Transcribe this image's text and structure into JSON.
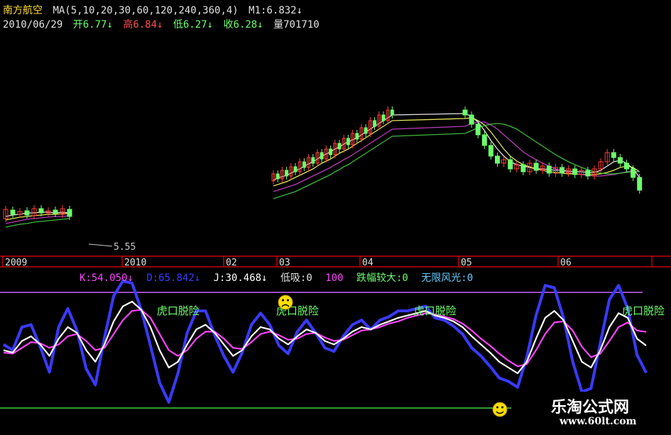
{
  "header": {
    "stock_name": "南方航空",
    "ma_params": "MA(5,10,20,30,60,120,240,360,4)",
    "m1": "M1:6.832",
    "m1_arrow": "↓",
    "date": "2010/06/29",
    "open": "开6.77",
    "open_arrow": "↓",
    "high": "高6.84",
    "high_arrow": "↓",
    "low": "低6.27",
    "low_arrow": "↓",
    "close": "收6.28",
    "close_arrow": "↓",
    "volume": "量701710"
  },
  "indicator_header": {
    "k": "K:54.050",
    "k_arrow": "↓",
    "d": "D:65.842",
    "d_arrow": "↓",
    "j": "J:30.468",
    "j_arrow": "↓",
    "dixi": "低吸:0",
    "hundred": "100",
    "diefu": "跌幅较大:0",
    "wuxian": "无限风光:0"
  },
  "colors": {
    "background": "#000000",
    "up_candle": "#ff3c3c",
    "down_candle": "#6cff6c",
    "k_line": "#ffffff",
    "d_line": "#ff44ff",
    "j_line": "#3a3aff",
    "signal_text": "#6cff6c",
    "axis": "#c80000",
    "level_high": "#cc66ff",
    "level_low": "#44cc44"
  },
  "chart_data": [
    {
      "type": "candlestick",
      "x_tick_labels": [
        "2009",
        "2010",
        "02",
        "03",
        "04",
        "05",
        "06"
      ],
      "price_label": "5.55",
      "candles_open_close": [
        [
          5.52,
          5.65
        ],
        [
          5.64,
          5.58
        ],
        [
          5.58,
          5.62
        ],
        [
          5.63,
          5.57
        ],
        [
          5.56,
          5.66
        ],
        [
          5.66,
          5.6
        ],
        [
          5.6,
          5.63
        ],
        [
          5.64,
          5.59
        ],
        [
          5.58,
          5.66
        ],
        [
          5.65,
          5.55
        ],
        [
          6.05,
          6.15
        ],
        [
          6.15,
          6.08
        ],
        [
          6.08,
          6.2
        ],
        [
          6.2,
          6.12
        ],
        [
          6.12,
          6.25
        ],
        [
          6.25,
          6.18
        ],
        [
          6.18,
          6.32
        ],
        [
          6.32,
          6.24
        ],
        [
          6.24,
          6.38
        ],
        [
          6.38,
          6.3
        ],
        [
          6.3,
          6.45
        ],
        [
          6.45,
          6.36
        ],
        [
          6.36,
          6.5
        ],
        [
          6.5,
          6.42
        ],
        [
          6.42,
          6.58
        ],
        [
          6.58,
          6.5
        ],
        [
          6.5,
          6.65
        ],
        [
          6.65,
          6.56
        ],
        [
          6.56,
          6.72
        ],
        [
          6.72,
          6.64
        ],
        [
          6.64,
          6.8
        ],
        [
          6.8,
          6.72
        ],
        [
          6.72,
          6.9
        ],
        [
          6.9,
          6.82
        ],
        [
          6.82,
          6.98
        ],
        [
          6.98,
          6.9
        ],
        [
          6.9,
          7.05
        ],
        [
          7.05,
          6.98
        ],
        [
          7.05,
          6.98
        ],
        [
          6.98,
          6.85
        ],
        [
          6.85,
          6.7
        ],
        [
          6.7,
          6.55
        ],
        [
          6.55,
          6.4
        ],
        [
          6.4,
          6.3
        ],
        [
          6.3,
          6.35
        ],
        [
          6.35,
          6.22
        ],
        [
          6.22,
          6.28
        ],
        [
          6.28,
          6.18
        ],
        [
          6.18,
          6.3
        ],
        [
          6.3,
          6.2
        ],
        [
          6.2,
          6.26
        ],
        [
          6.26,
          6.16
        ],
        [
          6.16,
          6.24
        ],
        [
          6.24,
          6.16
        ],
        [
          6.16,
          6.22
        ],
        [
          6.22,
          6.14
        ],
        [
          6.14,
          6.2
        ],
        [
          6.2,
          6.12
        ],
        [
          6.12,
          6.22
        ],
        [
          6.22,
          6.32
        ],
        [
          6.32,
          6.45
        ],
        [
          6.45,
          6.38
        ],
        [
          6.38,
          6.3
        ],
        [
          6.3,
          6.22
        ],
        [
          6.22,
          6.1
        ],
        [
          6.1,
          5.92
        ]
      ],
      "ma_series": [
        {
          "values": [
            5.55,
            5.57,
            5.58,
            5.6,
            5.6,
            5.61,
            5.61,
            5.6,
            5.61,
            5.6,
            6.06,
            6.09,
            6.11,
            6.13,
            6.16,
            6.19,
            6.22,
            6.26,
            6.29,
            6.32,
            6.36,
            6.4,
            6.43,
            6.46,
            6.5,
            6.53,
            6.57,
            6.6,
            6.63,
            6.66,
            6.7,
            6.74,
            6.78,
            6.82,
            6.86,
            6.9,
            6.94,
            6.98,
            7.0,
            6.96,
            6.88,
            6.76,
            6.62,
            6.5,
            6.4,
            6.32,
            6.28,
            6.26,
            6.24,
            6.22,
            6.22,
            6.21,
            6.2,
            6.2,
            6.19,
            6.18,
            6.18,
            6.17,
            6.17,
            6.2,
            6.26,
            6.32,
            6.34,
            6.3,
            6.22,
            6.1
          ]
        },
        {
          "values": [
            5.5,
            5.52,
            5.54,
            5.55,
            5.56,
            5.57,
            5.58,
            5.58,
            5.59,
            5.59,
            5.98,
            6.0,
            6.02,
            6.04,
            6.07,
            6.1,
            6.13,
            6.16,
            6.19,
            6.22,
            6.26,
            6.3,
            6.33,
            6.36,
            6.4,
            6.44,
            6.47,
            6.5,
            6.54,
            6.58,
            6.62,
            6.66,
            6.7,
            6.74,
            6.78,
            6.82,
            6.86,
            6.9,
            6.93,
            6.94,
            6.9,
            6.84,
            6.74,
            6.62,
            6.5,
            6.4,
            6.33,
            6.28,
            6.25,
            6.22,
            6.2,
            6.18,
            6.17,
            6.16,
            6.15,
            6.15,
            6.14,
            6.14,
            6.14,
            6.15,
            6.17,
            6.2,
            6.24,
            6.26,
            6.24,
            6.18
          ]
        },
        {
          "values": [
            5.45,
            5.47,
            5.49,
            5.51,
            5.52,
            5.53,
            5.54,
            5.55,
            5.55,
            5.56,
            5.9,
            5.92,
            5.94,
            5.96,
            5.98,
            6.0,
            6.03,
            6.06,
            6.09,
            6.12,
            6.15,
            6.18,
            6.21,
            6.24,
            6.28,
            6.31,
            6.35,
            6.38,
            6.42,
            6.46,
            6.5,
            6.54,
            6.58,
            6.62,
            6.66,
            6.7,
            6.74,
            6.78,
            6.82,
            6.86,
            6.88,
            6.88,
            6.84,
            6.78,
            6.7,
            6.62,
            6.54,
            6.46,
            6.4,
            6.35,
            6.3,
            6.26,
            6.22,
            6.19,
            6.17,
            6.15,
            6.14,
            6.13,
            6.12,
            6.12,
            6.13,
            6.14,
            6.16,
            6.18,
            6.19,
            6.18
          ]
        },
        {
          "values": [
            5.4,
            5.42,
            5.44,
            5.45,
            5.47,
            5.48,
            5.49,
            5.5,
            5.51,
            5.52,
            5.8,
            5.82,
            5.84,
            5.86,
            5.88,
            5.9,
            5.93,
            5.96,
            5.99,
            6.02,
            6.05,
            6.08,
            6.11,
            6.14,
            6.18,
            6.21,
            6.25,
            6.28,
            6.32,
            6.36,
            6.4,
            6.44,
            6.48,
            6.52,
            6.56,
            6.6,
            6.64,
            6.68,
            6.72,
            6.76,
            6.8,
            6.83,
            6.85,
            6.86,
            6.85,
            6.82,
            6.78,
            6.72,
            6.66,
            6.6,
            6.54,
            6.48,
            6.42,
            6.37,
            6.32,
            6.28,
            6.24,
            6.21,
            6.18,
            6.16,
            6.15,
            6.15,
            6.16,
            6.17,
            6.18,
            6.18
          ]
        }
      ]
    },
    {
      "type": "line",
      "ylim": [
        0,
        100
      ],
      "series": [
        {
          "name": "K",
          "values": [
            50,
            48,
            58,
            62,
            55,
            45,
            60,
            70,
            65,
            50,
            40,
            55,
            75,
            88,
            92,
            85,
            70,
            50,
            35,
            40,
            55,
            68,
            72,
            65,
            55,
            45,
            50,
            62,
            70,
            68,
            60,
            55,
            62,
            68,
            65,
            58,
            55,
            60,
            66,
            70,
            68,
            72,
            75,
            78,
            80,
            82,
            84,
            80,
            78,
            75,
            70,
            62,
            55,
            48,
            40,
            35,
            30,
            40,
            60,
            78,
            84,
            76,
            58,
            40,
            35,
            50,
            70,
            82,
            78,
            60,
            54
          ]
        },
        {
          "name": "D",
          "values": [
            48,
            47,
            52,
            57,
            56,
            52,
            55,
            62,
            64,
            58,
            50,
            52,
            64,
            76,
            84,
            85,
            78,
            64,
            50,
            45,
            50,
            60,
            66,
            66,
            60,
            52,
            51,
            57,
            64,
            66,
            63,
            59,
            60,
            64,
            65,
            61,
            58,
            59,
            63,
            67,
            68,
            70,
            73,
            75,
            78,
            80,
            82,
            81,
            79,
            77,
            73,
            67,
            60,
            54,
            47,
            41,
            36,
            38,
            50,
            64,
            74,
            75,
            67,
            53,
            44,
            47,
            58,
            70,
            74,
            67,
            65.8
          ]
        },
        {
          "name": "J",
          "values": [
            55,
            50,
            70,
            72,
            53,
            31,
            70,
            86,
            67,
            34,
            20,
            61,
            97,
            112,
            108,
            85,
            54,
            22,
            5,
            30,
            65,
            84,
            84,
            63,
            45,
            31,
            48,
            72,
            82,
            72,
            54,
            47,
            66,
            76,
            65,
            52,
            49,
            62,
            72,
            76,
            68,
            76,
            79,
            84,
            84,
            86,
            88,
            78,
            76,
            71,
            64,
            52,
            45,
            36,
            26,
            23,
            18,
            44,
            80,
            106,
            104,
            78,
            40,
            14,
            17,
            56,
            94,
            106,
            86,
            46,
            30.5
          ]
        }
      ],
      "signals": [
        {
          "label": "虎口脱险",
          "index": 17
        },
        {
          "label": "虎口脱险",
          "index": 30
        },
        {
          "label": "虎口脱险",
          "index": 45
        },
        {
          "label": "虎口脱险",
          "index": 68
        }
      ]
    }
  ],
  "watermark": {
    "title": "乐淘公式网",
    "url": "www.60lt.com"
  }
}
